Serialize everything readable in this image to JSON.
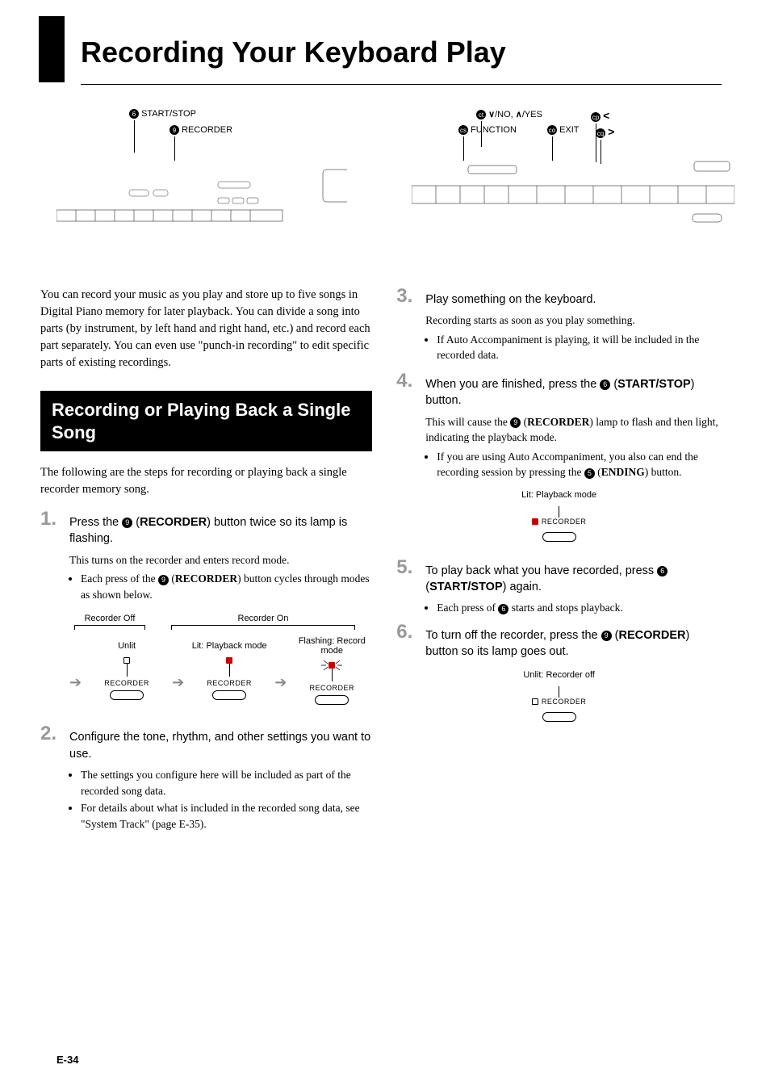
{
  "page": {
    "title": "Recording Your Keyboard Play",
    "footer": "E-34"
  },
  "diagram": {
    "labels": {
      "start_stop": "START/STOP",
      "recorder": "RECORDER",
      "no_yes": "/NO, ",
      "no_yes_suffix": "/YES",
      "function": "FUNCTION",
      "exit": "EXIT"
    },
    "callout_6": "6",
    "callout_9": "9",
    "callout_ct": "ct",
    "callout_cs": "cs",
    "callout_cp": "cp",
    "callout_cq": "cq",
    "down_sym": "∨",
    "up_sym": "∧",
    "lt_sym": "<",
    "gt_sym": ">"
  },
  "intro": "You can record your music as you play and store up to five songs in Digital Piano memory for later playback. You can divide a song into parts (by instrument, by left hand and right hand, etc.) and record each part separately. You can even use \"punch-in recording\" to edit specific parts of existing recordings.",
  "section": {
    "heading": "Recording or Playing Back a Single Song",
    "intro": "The following are the steps for recording or playing back a single recorder memory song."
  },
  "steps": {
    "s1": {
      "text_pre": "Press the ",
      "text_mid": " (",
      "text_bold": "RECORDER",
      "text_post": ") button twice so its lamp is flashing.",
      "sub1": "This turns on the recorder and enters record mode.",
      "sub2_pre": "Each press of the ",
      "sub2_mid": " (",
      "sub2_bold": "RECORDER",
      "sub2_post": ") button cycles through modes as shown below."
    },
    "s2": {
      "text": "Configure the tone, rhythm, and other settings you want to use.",
      "sub1": "The settings you configure here will be included as part of the recorded song data.",
      "sub2": "For details about what is included in the recorded song data, see \"System Track\" (page E-35)."
    },
    "s3": {
      "text": "Play something on the keyboard.",
      "sub1": "Recording starts as soon as you play something.",
      "sub2": "If Auto Accompaniment is playing, it will be included in the recorded data."
    },
    "s4": {
      "text_pre": "When you are finished, press the ",
      "text_mid": " (",
      "text_bold1": "START/STOP",
      "text_post": ") button.",
      "sub1_pre": "This will cause the ",
      "sub1_mid": " (",
      "sub1_bold": "RECORDER",
      "sub1_post": ") lamp to flash and then light, indicating the playback mode.",
      "sub2_pre": "If you are using Auto Accompaniment, you also can end the recording session by pressing the ",
      "sub2_mid": " (",
      "sub2_bold": "ENDING",
      "sub2_post": ") button."
    },
    "s5": {
      "text_pre": "To play back what you have recorded, press ",
      "text_mid": " (",
      "text_bold": "START/STOP",
      "text_post": ") again.",
      "sub1_pre": "Each press of ",
      "sub1_post": " starts and stops playback."
    },
    "s6": {
      "text_pre": "To turn off the recorder, press the ",
      "text_mid": " (",
      "text_bold": "RECORDER",
      "text_post": ") button so its lamp goes out."
    }
  },
  "rec_diagram": {
    "off": "Recorder Off",
    "on": "Recorder On",
    "unlit": "Unlit",
    "playback": "Lit: Playback mode",
    "flashing": "Flashing: Record mode",
    "label": "RECORDER"
  },
  "small_diagrams": {
    "playback_caption": "Lit: Playback mode",
    "off_caption": "Unlit: Recorder off",
    "label": "RECORDER"
  }
}
